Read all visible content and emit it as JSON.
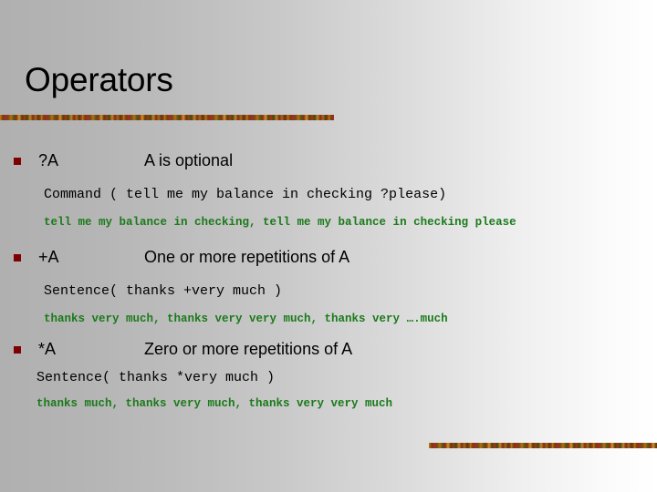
{
  "slide": {
    "title": "Operators",
    "background_gradient_from": "#b0b0b0",
    "background_gradient_to": "#ffffff",
    "bullet_color": "#7f0000",
    "result_text_color": "#1a7a1a",
    "decor_bar_color": "#8a5a14"
  },
  "items": [
    {
      "operator": "?A",
      "description": "A is optional",
      "code": "Command ( tell me my balance in checking ?please)",
      "result": "tell me my balance in checking, tell me my balance in checking please"
    },
    {
      "operator": "+A",
      "description": "One or more repetitions of A",
      "code": "Sentence( thanks +very much )",
      "result": "thanks very much, thanks very very much, thanks very ….much"
    },
    {
      "operator": "*A",
      "description": "Zero or more repetitions of A",
      "code": "Sentence( thanks *very much )",
      "result": "thanks much, thanks very much, thanks very very much"
    }
  ]
}
